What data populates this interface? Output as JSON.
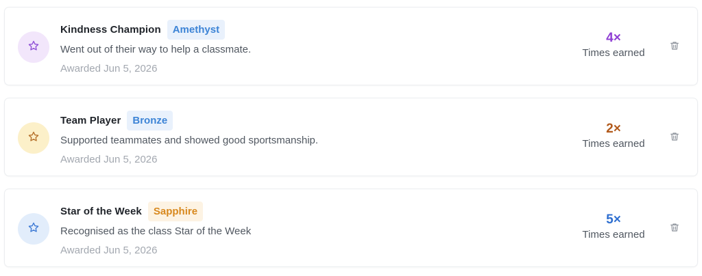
{
  "awards": [
    {
      "title": "Kindness Champion",
      "tier": "Amethyst",
      "description": "Went out of their way to help a classmate.",
      "awarded": "Awarded Jun 5, 2026",
      "count": "4×",
      "count_label": "Times earned",
      "icon": "star-icon",
      "colors": {
        "avatar_bg": "#f2e6fb",
        "icon": "#8f4fd6",
        "badge_bg": "#e9f1fc",
        "badge_text": "#3d84d6",
        "count": "#8f3fd4"
      }
    },
    {
      "title": "Team Player",
      "tier": "Bronze",
      "description": "Supported teammates and showed good sportsmanship.",
      "awarded": "Awarded Jun 5, 2026",
      "count": "2×",
      "count_label": "Times earned",
      "icon": "star-icon",
      "colors": {
        "avatar_bg": "#fcf0c9",
        "icon": "#b5702a",
        "badge_bg": "#e9f1fc",
        "badge_text": "#3d84d6",
        "count": "#b25a1c"
      }
    },
    {
      "title": "Star of the Week",
      "tier": "Sapphire",
      "description": "Recognised as the class Star of the Week",
      "awarded": "Awarded Jun 5, 2026",
      "count": "5×",
      "count_label": "Times earned",
      "icon": "star-icon",
      "colors": {
        "avatar_bg": "#e2edfb",
        "icon": "#3b78d4",
        "badge_bg": "#fdf3e3",
        "badge_text": "#d8891f",
        "count": "#2f6fd0"
      }
    }
  ],
  "delete_icon": "trash-icon"
}
